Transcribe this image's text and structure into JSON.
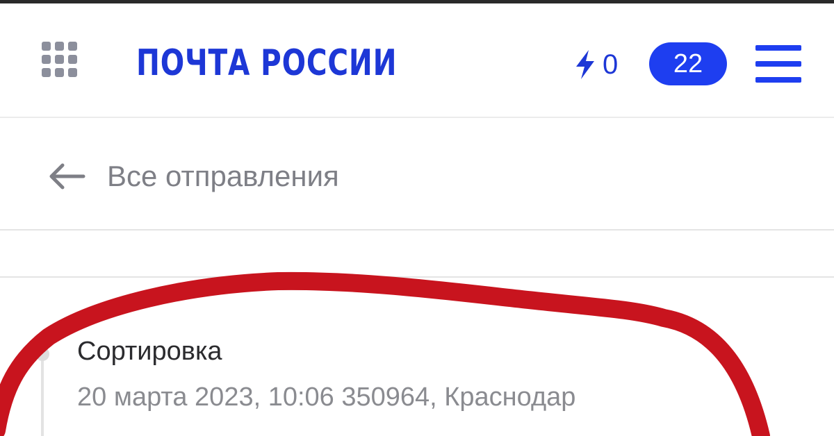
{
  "header": {
    "logo_text": "ПОЧТА РОССИИ",
    "bonus_count": "0",
    "notifications_count": "22",
    "icons": {
      "apps": "apps-grid-icon",
      "bonus": "lightning-bolt-icon",
      "menu": "hamburger-menu-icon"
    }
  },
  "navigation": {
    "back_label": "Все отправления",
    "back_icon": "arrow-left-icon"
  },
  "tracking": {
    "events": [
      {
        "status": "Сортировка",
        "details": "20 марта 2023, 10:06 350964, Краснодар"
      }
    ]
  },
  "colors": {
    "brand_blue": "#1d37d6",
    "badge_blue": "#1e3ef0",
    "grey_icon": "#8c8f9c",
    "muted_text": "#7e7f86",
    "annotation_red": "#c8141e"
  }
}
